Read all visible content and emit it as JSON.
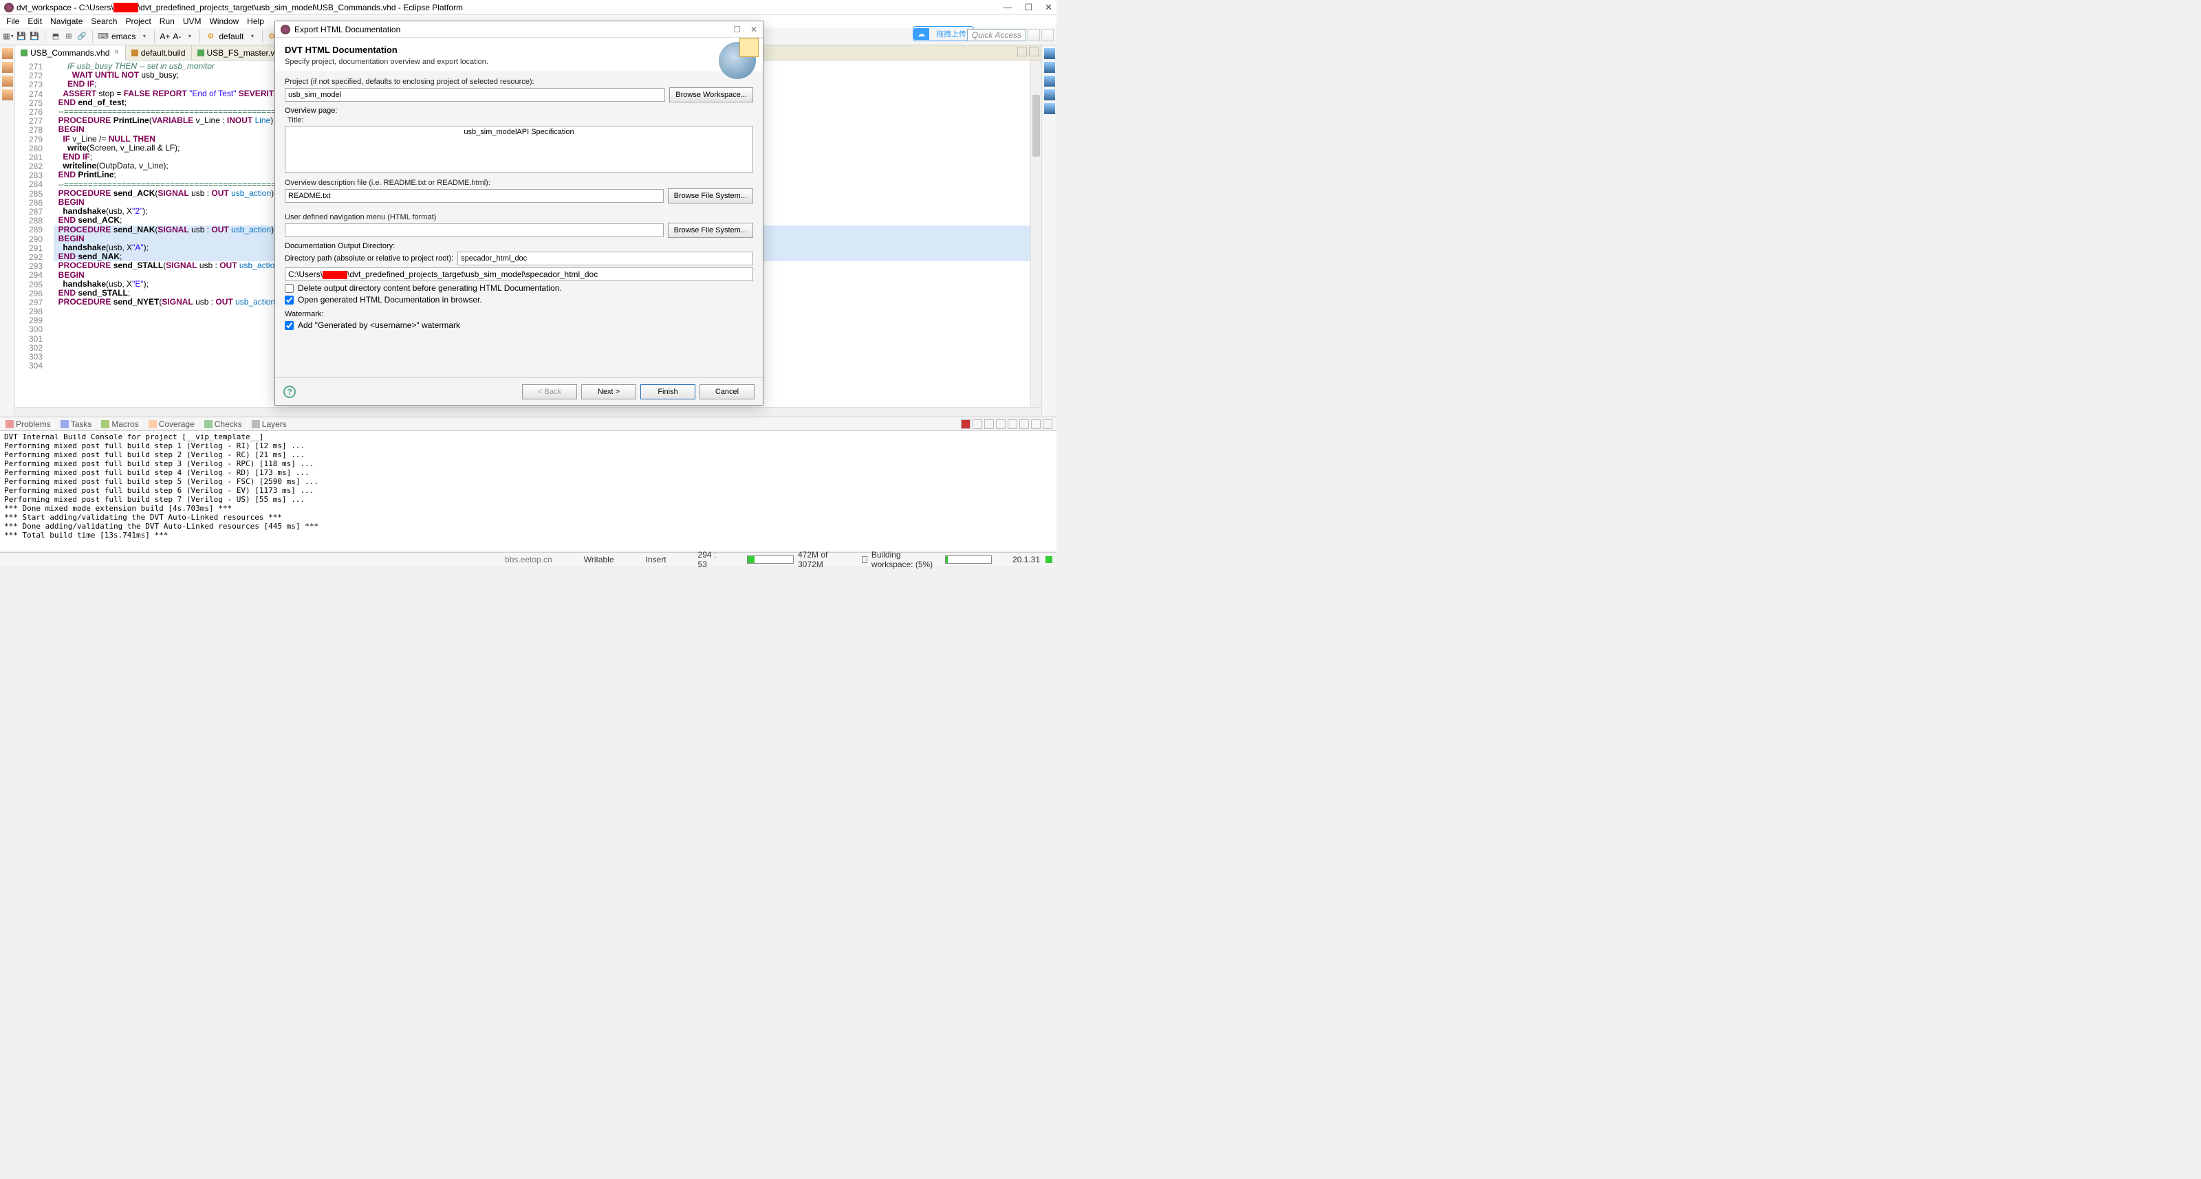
{
  "window": {
    "title_pre": "dvt_workspace - C:\\Users\\",
    "title_post": "\\dvt_predefined_projects_target\\usb_sim_model\\USB_Commands.vhd - Eclipse Platform",
    "controls": {
      "min": "—",
      "max": "☐",
      "close": "✕"
    }
  },
  "menu": [
    "File",
    "Edit",
    "Navigate",
    "Search",
    "Project",
    "Run",
    "UVM",
    "Window",
    "Help"
  ],
  "toolbar": {
    "emacs": "emacs",
    "font": {
      "inc": "A+",
      "dec": "A-"
    },
    "default": "default",
    "quick_access": "Quick Access",
    "zh": {
      "a": "☁",
      "b": "拖拽上传"
    }
  },
  "tabs": [
    {
      "label": "USB_Commands.vhd",
      "active": true
    },
    {
      "label": "default.build",
      "active": false
    },
    {
      "label": "USB_FS_master.vhd",
      "active": false
    }
  ],
  "code": {
    "lines": [
      {
        "n": 271,
        "raw": "      IF usb_busy THEN -- set in usb_monitor",
        "cls": "cm"
      },
      {
        "n": 272,
        "raw": "        WAIT UNTIL NOT usb_busy;"
      },
      {
        "n": 273,
        "raw": "      END IF;"
      },
      {
        "n": 274,
        "raw": "    ASSERT stop = FALSE REPORT \"End of Test\" SEVERITY failure;"
      },
      {
        "n": 275,
        "raw": "  END end_of_test;"
      },
      {
        "n": 276,
        "raw": ""
      },
      {
        "n": 277,
        "raw": "  --================================================================--",
        "cls": "cm"
      },
      {
        "n": 278,
        "raw": ""
      },
      {
        "n": 279,
        "raw": "  PROCEDURE PrintLine(VARIABLE v_Line : INOUT Line) IS"
      },
      {
        "n": 280,
        "raw": "  BEGIN"
      },
      {
        "n": 281,
        "raw": "    IF v_Line /= NULL THEN"
      },
      {
        "n": 282,
        "raw": "      write(Screen, v_Line.all & LF);"
      },
      {
        "n": 283,
        "raw": "    END IF;"
      },
      {
        "n": 284,
        "raw": "    writeline(OutpData, v_Line);"
      },
      {
        "n": 285,
        "raw": "  END PrintLine;"
      },
      {
        "n": 286,
        "raw": ""
      },
      {
        "n": 287,
        "raw": "  --================================================================--",
        "cls": "cm"
      },
      {
        "n": 288,
        "raw": ""
      },
      {
        "n": 289,
        "raw": "  PROCEDURE send_ACK(SIGNAL usb : OUT usb_action) IS"
      },
      {
        "n": 290,
        "raw": "  BEGIN"
      },
      {
        "n": 291,
        "raw": "    handshake(usb, X\"2\");"
      },
      {
        "n": 292,
        "raw": "  END send_ACK;"
      },
      {
        "n": 293,
        "raw": ""
      },
      {
        "n": 294,
        "raw": "  PROCEDURE send_NAK(SIGNAL usb : OUT usb_action) IS",
        "hl": true
      },
      {
        "n": 295,
        "raw": "  BEGIN",
        "hl": true
      },
      {
        "n": 296,
        "raw": "    handshake(usb, X\"A\");",
        "hl": true
      },
      {
        "n": 297,
        "raw": "  END send_NAK;",
        "hl": true
      },
      {
        "n": 298,
        "raw": ""
      },
      {
        "n": 299,
        "raw": "  PROCEDURE send_STALL(SIGNAL usb : OUT usb_action) IS"
      },
      {
        "n": 300,
        "raw": "  BEGIN"
      },
      {
        "n": 301,
        "raw": "    handshake(usb, X\"E\");"
      },
      {
        "n": 302,
        "raw": "  END send_STALL;"
      },
      {
        "n": 303,
        "raw": ""
      },
      {
        "n": 304,
        "raw": "  PROCEDURE send_NYET(SIGNAL usb : OUT usb_action) IS"
      }
    ]
  },
  "bottom_tabs": [
    "Problems",
    "Tasks",
    "Macros",
    "Coverage",
    "Checks",
    "Layers"
  ],
  "console": {
    "header": "DVT Internal Build Console for project [__vip_template__]",
    "lines": [
      "Performing mixed post full build step 1 (Verilog - RI) [12 ms] ...",
      "Performing mixed post full build step 2 (Verilog - RC) [21 ms] ...",
      "Performing mixed post full build step 3 (Verilog - RPC) [118 ms] ...",
      "Performing mixed post full build step 4 (Verilog - RD) [173 ms] ...",
      "Performing mixed post full build step 5 (Verilog - FSC) [2590 ms] ...",
      "Performing mixed post full build step 6 (Verilog - EV) [1173 ms] ...",
      "Performing mixed post full build step 7 (Verilog - US) [55 ms] ...",
      "*** Done mixed mode extension build [4s.703ms] ***",
      "*** Start adding/validating the DVT Auto-Linked resources ***",
      "*** Done adding/validating the DVT Auto-Linked resources [445 ms] ***",
      "*** Total build time [13s.741ms] ***"
    ]
  },
  "status": {
    "site": "bbs.eetop.cn",
    "writable": "Writable",
    "insert": "Insert",
    "pos": "294 : 53",
    "mem": "472M of 3072M",
    "build": "Building workspace: (5%)",
    "ver": "20.1.31"
  },
  "dialog": {
    "title": "Export HTML Documentation",
    "heading": "DVT HTML Documentation",
    "sub": "Specify project, documentation overview and export location.",
    "project_lbl": "Project (if not specified, defaults to enclosing project of selected resource):",
    "project_val": "usb_sim_model",
    "browse_ws": "Browse Workspace...",
    "overview": "Overview page:",
    "title_lbl": "Title:",
    "title_val": "usb_sim_modelAPI Specification",
    "odf_lbl": "Overview description file (i.e. README.txt or README.html):",
    "odf_val": "README.txt",
    "browse_fs": "Browse File System...",
    "nav_lbl": "User defined navigation menu (HTML format)",
    "nav_val": "",
    "outdir": "Documentation Output Directory:",
    "dirpath_lbl": "Directory path (absolute or relative to project root):",
    "dirpath_val": "specador_html_doc",
    "fullpath_pre": "C:\\Users\\",
    "fullpath_post": "\\dvt_predefined_projects_target\\usb_sim_model\\specador_html_doc",
    "chk_delete": "Delete output directory content before generating HTML Documentation.",
    "chk_open": "Open generated HTML Documentation in browser.",
    "watermark": "Watermark:",
    "chk_wm": "Add \"Generated by <username>\" watermark",
    "back": "< Back",
    "next": "Next >",
    "finish": "Finish",
    "cancel": "Cancel"
  }
}
